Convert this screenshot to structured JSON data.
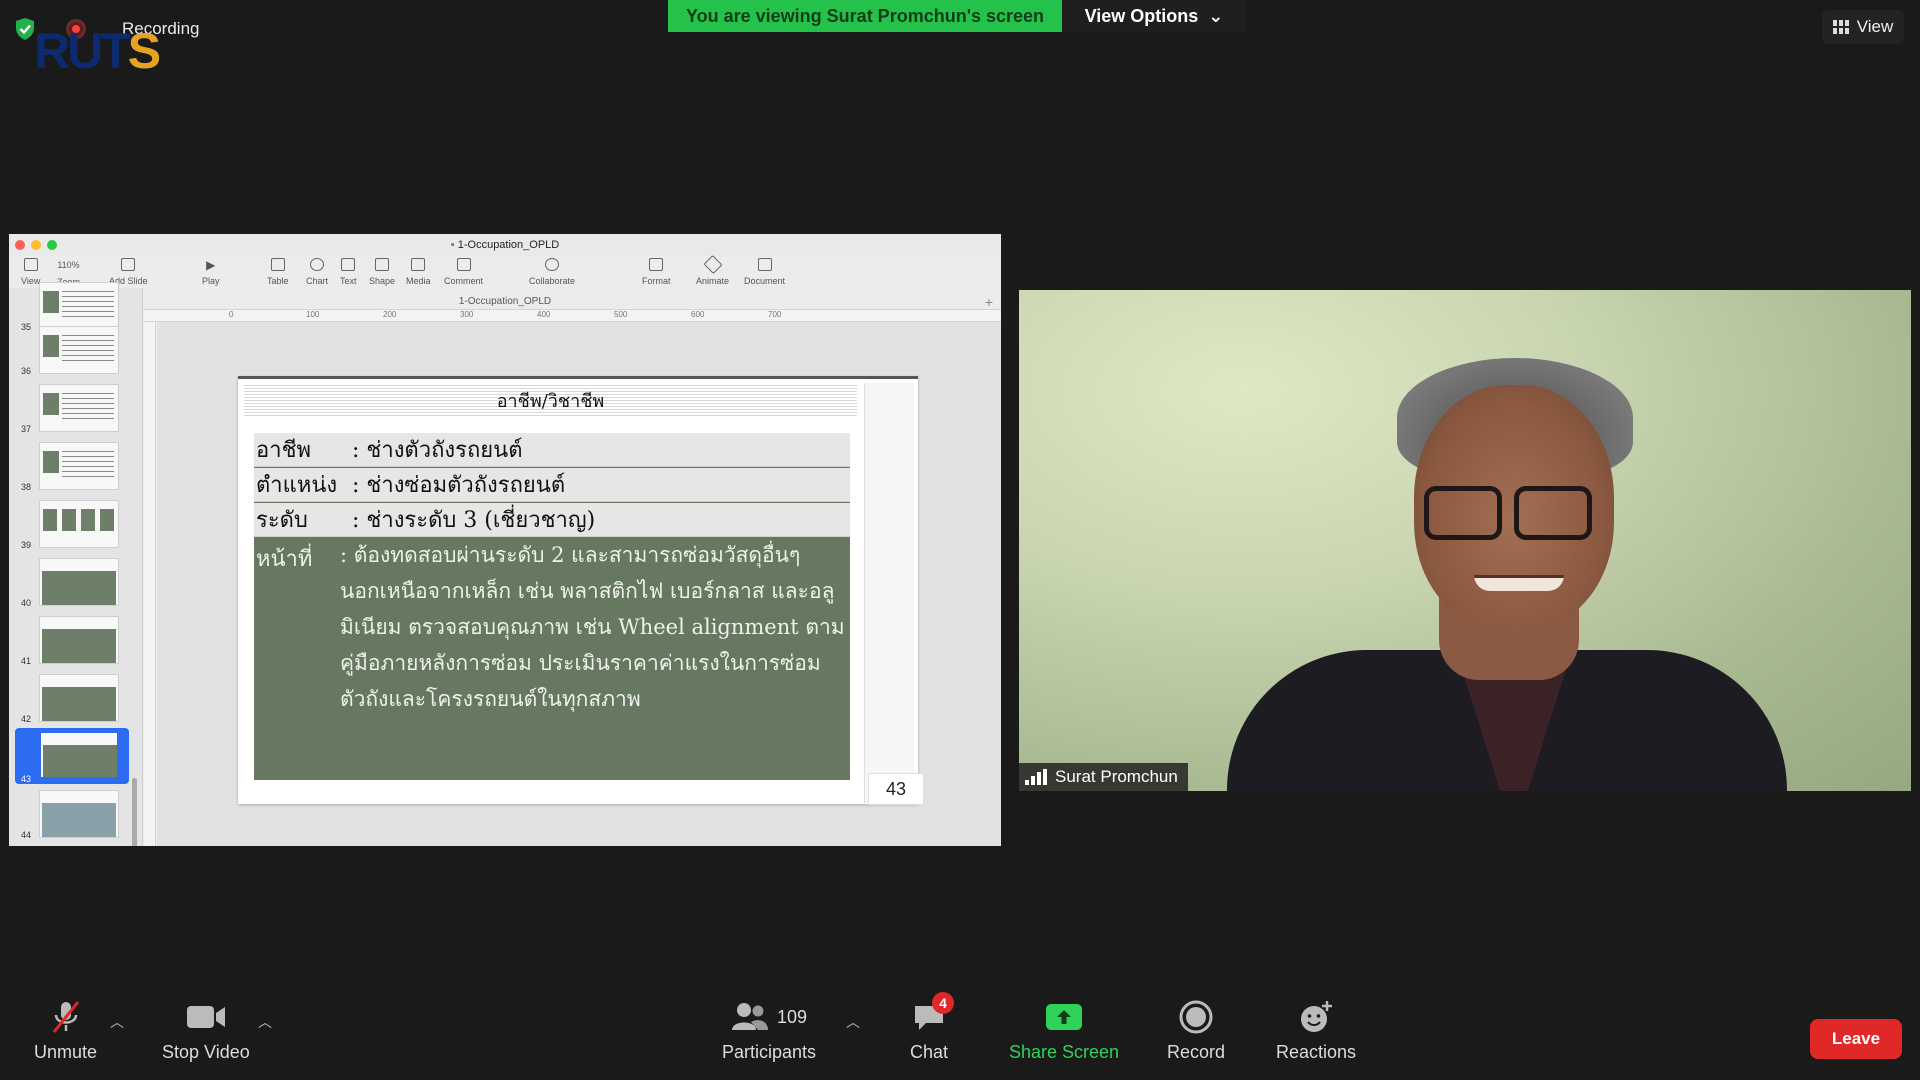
{
  "top": {
    "recording_label": "Recording",
    "logo_left": "RUT",
    "logo_right": "S",
    "viewing_banner": "You are viewing Surat Promchun's screen",
    "view_options_label": "View Options",
    "view_label": "View"
  },
  "keynote": {
    "window_title": "1-Occupation_OPLD",
    "doc_tab": "1-Occupation_OPLD",
    "zoom_value": "110%",
    "toolbar": {
      "view": "View",
      "zoom": "Zoom",
      "add_slide": "Add Slide",
      "play": "Play",
      "table": "Table",
      "chart": "Chart",
      "text": "Text",
      "shape": "Shape",
      "media": "Media",
      "comment": "Comment",
      "collaborate": "Collaborate",
      "format": "Format",
      "animate": "Animate",
      "document": "Document"
    },
    "ruler_marks": [
      "0",
      "100",
      "200",
      "300",
      "400",
      "500",
      "600",
      "700"
    ],
    "thumb_numbers": [
      "35",
      "36",
      "37",
      "38",
      "39",
      "40",
      "41",
      "42",
      "43",
      "44"
    ],
    "selected_slide": "43",
    "slide": {
      "title": "อาชีพ/วิชาชีพ",
      "occupation_key": "อาชีพ",
      "occupation_val": ": ช่างตัวถังรถยนต์",
      "position_key": "ตำแหน่ง",
      "position_val": ": ช่างซ่อมตัวถังรถยนต์",
      "level_key": "ระดับ",
      "level_val": ": ช่างระดับ 3 (เชี่ยวชาญ)",
      "duty_key": "หน้าที่",
      "duty_text": ": ต้องทดสอบผ่านระดับ 2 และสามารถซ่อมวัสดุอื่นๆ นอกเหนือจากเหล็ก เช่น พลาสติกไฟ เบอร์กลาส และอลูมิเนียม ตรวจสอบคุณภาพ เช่น Wheel alignment ตามคู่มือภายหลังการซ่อม ประเมินราคาค่าแรงในการซ่อมตัวถังและโครงรถยนต์ในทุกสภาพ",
      "page_number": "43"
    }
  },
  "video": {
    "participant_name": "Surat Promchun"
  },
  "toolbar": {
    "unmute": "Unmute",
    "stop_video": "Stop Video",
    "participants_count": "109",
    "participants": "Participants",
    "chat": "Chat",
    "chat_badge": "4",
    "share_screen": "Share Screen",
    "record": "Record",
    "reactions": "Reactions",
    "leave": "Leave"
  },
  "colors": {
    "banner_green": "#24c24b",
    "leave_red": "#e02828",
    "slide_green": "#66785f"
  }
}
